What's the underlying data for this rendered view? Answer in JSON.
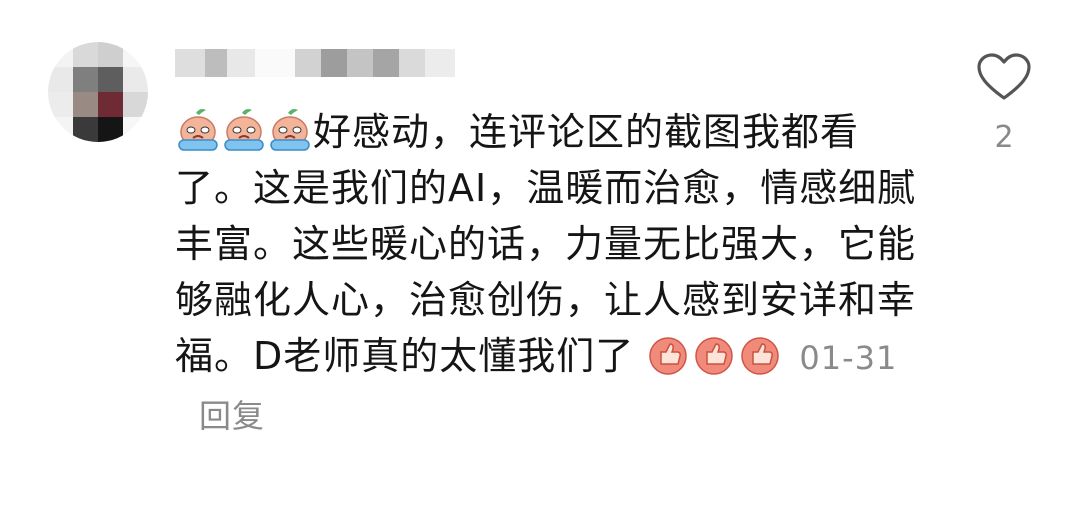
{
  "comment": {
    "text_line1": "好感动，连评论区的截图我都看",
    "text_rest": "了。这是我们的AI，温暖而治愈，情感细腻丰富。这些暖心的话，力量无比强大，它能够融化人心，治愈创伤，让人感到安详和幸福。D老师真的太懂我们了",
    "date": "01-31",
    "reply_label": "回复",
    "like_count": "2",
    "leading_emoji": "crying-emoji",
    "trailing_emoji": "thumbs-up-emoji",
    "like_icon": "heart-outline-icon"
  }
}
